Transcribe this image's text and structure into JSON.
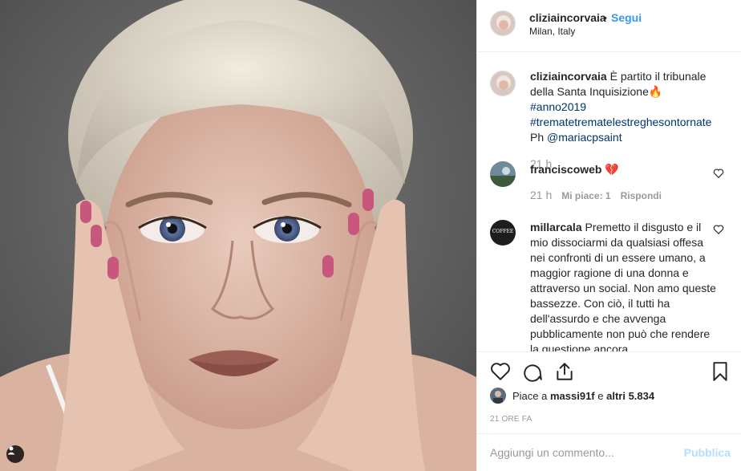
{
  "post": {
    "author": "cliziaincorvaia",
    "follow_label": "Segui",
    "location": "Milan, Italy",
    "bullet": "•"
  },
  "caption": {
    "username": "cliziaincorvaia",
    "text_1": "È partito il tribunale della Santa Inquisizione",
    "emoji": "🔥",
    "tag_1": "#anno2019",
    "tag_2": "#trematetrematelestreghesontornate",
    "text_2": "Ph ",
    "mention": "@mariacpsaint",
    "time": "21 h"
  },
  "comments": [
    {
      "username": "franciscoweb",
      "text": "💔",
      "time": "21 h",
      "likes_label": "Mi piace: 1",
      "reply_label": "Rispondi"
    },
    {
      "username": "millarcala",
      "text": "Premetto il disgusto e il mio dissociarmi da qualsiasi offesa nei confronti di un essere umano, a maggior ragione di una donna e attraverso un social. Non amo queste bassezze. Con ciò, il tutti ha dell'assurdo e che avvenga pubblicamente non può che rendere la questione ancora",
      "avatar_text": "COFFEE"
    }
  ],
  "likes": {
    "prefix": "Piace a ",
    "user": "massi91f",
    "middle": " e ",
    "others": "altri 5.834"
  },
  "time_ago": "21 ORE FA",
  "add_comment": {
    "placeholder": "Aggiungi un commento...",
    "publish_label": "Pubblica"
  },
  "icons": {
    "like": "heart-icon",
    "comment": "comment-icon",
    "share": "share-icon",
    "save": "bookmark-icon",
    "tags": "user-tag-icon"
  },
  "colors": {
    "link_blue": "#3897f0",
    "hashtag": "#003569",
    "muted": "#999999",
    "publish_disabled": "#b2dffc"
  }
}
